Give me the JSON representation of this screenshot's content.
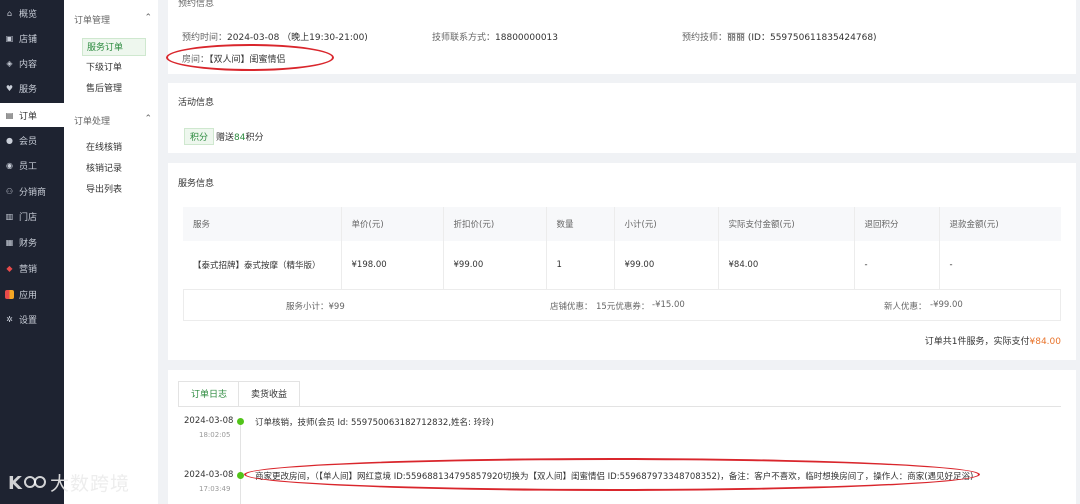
{
  "nav": [
    {
      "icon": "home-icon",
      "glyph": "⌂",
      "label": "概览"
    },
    {
      "icon": "shop-icon",
      "glyph": "▣",
      "label": "店铺"
    },
    {
      "icon": "content-icon",
      "glyph": "◈",
      "label": "内容"
    },
    {
      "icon": "service-icon",
      "glyph": "♥",
      "label": "服务"
    },
    {
      "icon": "order-icon",
      "glyph": "▤",
      "label": "订单"
    },
    {
      "icon": "member-icon",
      "glyph": "●",
      "label": "会员"
    },
    {
      "icon": "staff-icon",
      "glyph": "◉",
      "label": "员工"
    },
    {
      "icon": "distributor-icon",
      "glyph": "⚇",
      "label": "分销商"
    },
    {
      "icon": "store-icon",
      "glyph": "▥",
      "label": "门店"
    },
    {
      "icon": "finance-icon",
      "glyph": "▦",
      "label": "财务"
    },
    {
      "icon": "marketing-icon",
      "glyph": "◆",
      "label": "营销"
    },
    {
      "icon": "apps-icon",
      "glyph": "▪",
      "label": "应用"
    },
    {
      "icon": "settings-icon",
      "glyph": "✲",
      "label": "设置"
    }
  ],
  "submenu": {
    "group1": "订单管理",
    "group1_items": [
      "服务订单",
      "下级订单",
      "售后管理"
    ],
    "group2": "订单处理",
    "group2_items": [
      "在线核销",
      "核销记录",
      "导出列表"
    ]
  },
  "booking": {
    "title": "预约信息",
    "time_label": "预约时间：",
    "time_value": "2024-03-08 （晚上19:30-21:00)",
    "contact_label": "技师联系方式：",
    "contact_value": "18800000013",
    "tech_label": "预约技师：",
    "tech_value": "丽丽 (ID：559750611835424768)",
    "room_label": "房间：",
    "room_value": "【双人间】闺蜜情侣"
  },
  "activity": {
    "title": "活动信息",
    "badge": "积分",
    "text_pre": "赠送",
    "points": "84",
    "text_post": "积分"
  },
  "service": {
    "title": "服务信息",
    "headers": [
      "服务",
      "单价(元)",
      "折扣价(元)",
      "数量",
      "小计(元)",
      "实际支付金额(元)",
      "退回积分",
      "退款金额(元)"
    ],
    "row": [
      "【泰式招牌】泰式按摩（精华版）",
      "¥198.00",
      "¥99.00",
      "1",
      "¥99.00",
      "¥84.00",
      "-",
      "-"
    ],
    "subtotal": "服务小计：¥99",
    "store_discount": "店铺优惠：",
    "coupon": "15元优惠券：",
    "coupon_value": "-¥15.00",
    "new_discount": "新人优惠：",
    "new_discount_value": "-¥99.00",
    "total_pre": "订单共1件服务，实际支付",
    "total_value": "¥84.00"
  },
  "log": {
    "tabs": [
      "订单日志",
      "卖货收益"
    ],
    "entries": [
      {
        "date": "2024-03-08",
        "time": "18:02:05",
        "text": "订单核销，技师(会员 Id: 559750063182712832,姓名: 玲玲)"
      },
      {
        "date": "2024-03-08",
        "time": "17:03:49",
        "text": "商家更改房间，（【单人间】网红意境 ID:559688134795857920切换为【双人间】闺蜜情侣 ID:559687973348708352)，备注：客户不喜欢，临时想换房间了，操作人：商家(遇见好足浴)"
      }
    ]
  },
  "watermark": "大数跨境",
  "colors": {
    "accent": "#2b8a3e",
    "price": "#e8742c",
    "annotation": "#d9262c",
    "sidebar": "#1e2331"
  }
}
